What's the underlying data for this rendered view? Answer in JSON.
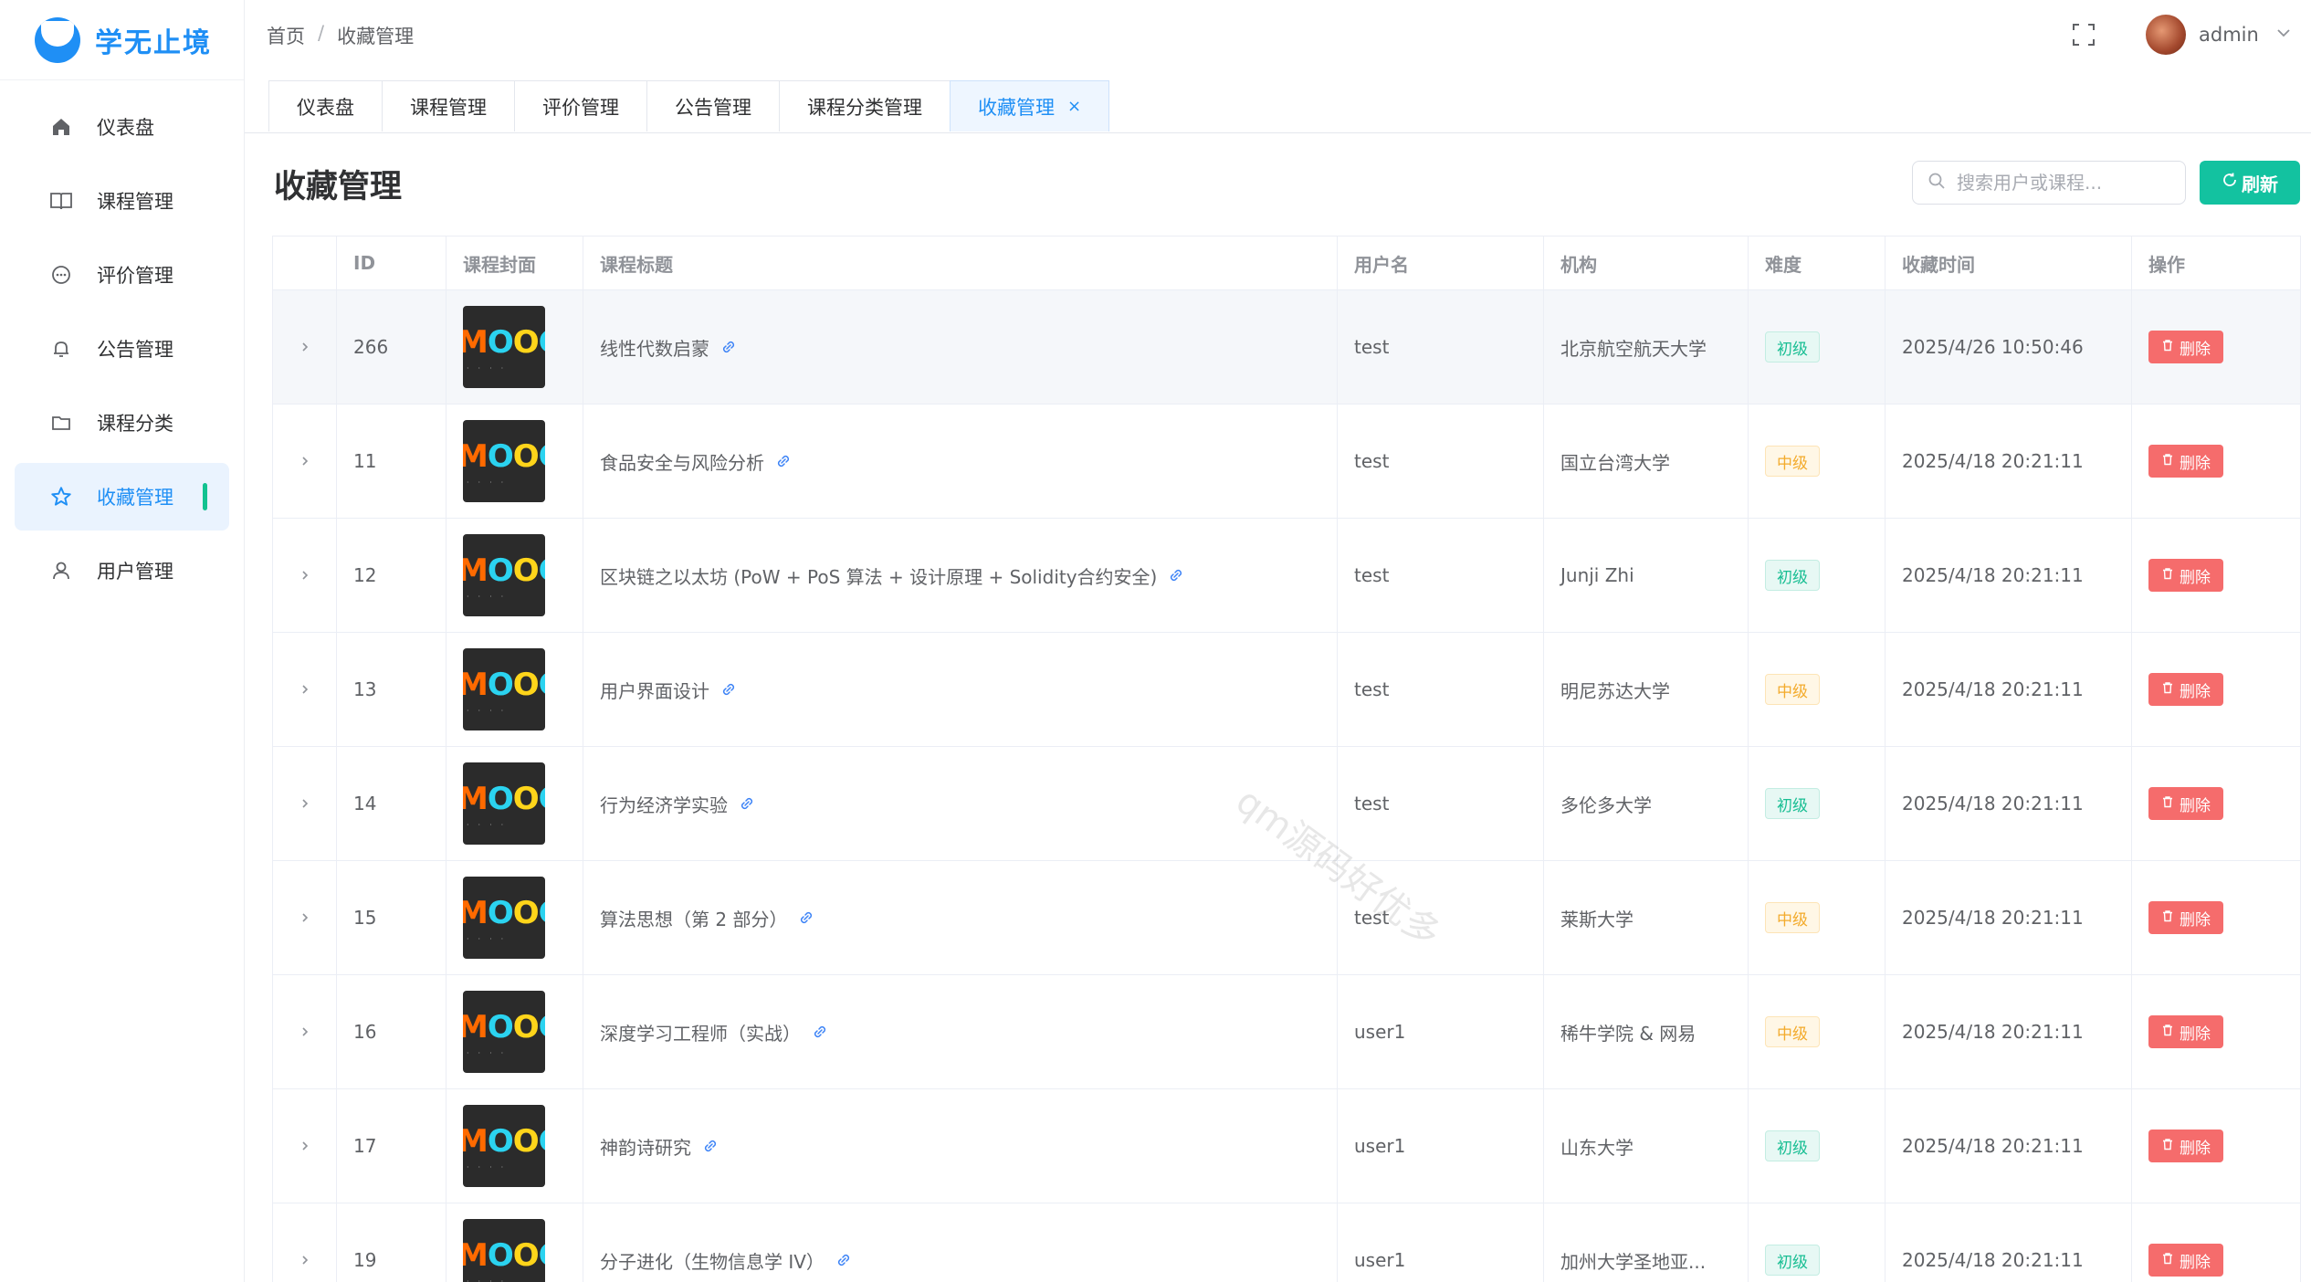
{
  "app": {
    "name": "学无止境"
  },
  "sidebar": {
    "items": [
      {
        "label": "仪表盘",
        "icon": "home-icon"
      },
      {
        "label": "课程管理",
        "icon": "book-icon"
      },
      {
        "label": "评价管理",
        "icon": "chat-icon"
      },
      {
        "label": "公告管理",
        "icon": "bell-icon"
      },
      {
        "label": "课程分类",
        "icon": "folder-icon"
      },
      {
        "label": "收藏管理",
        "icon": "star-icon",
        "active": true
      },
      {
        "label": "用户管理",
        "icon": "user-icon"
      }
    ]
  },
  "header": {
    "breadcrumb": [
      "首页",
      "收藏管理"
    ],
    "username": "admin"
  },
  "tabs": [
    {
      "label": "仪表盘"
    },
    {
      "label": "课程管理"
    },
    {
      "label": "评价管理"
    },
    {
      "label": "公告管理"
    },
    {
      "label": "课程分类管理"
    },
    {
      "label": "收藏管理",
      "active": true,
      "close": "×"
    }
  ],
  "page": {
    "title": "收藏管理",
    "search_placeholder": "搜索用户或课程...",
    "refresh_label": "刷新"
  },
  "table": {
    "columns": [
      "ID",
      "课程封面",
      "课程标题",
      "用户名",
      "机构",
      "难度",
      "收藏时间",
      "操作"
    ],
    "cover_text": "MOOC",
    "delete_label": "删除",
    "rows": [
      {
        "id": "266",
        "title": "线性代数启蒙",
        "user": "test",
        "org": "北京航空航天大学",
        "difficulty": "初级",
        "level": "easy",
        "time": "2025/4/26 10:50:46"
      },
      {
        "id": "11",
        "title": "食品安全与风险分析",
        "user": "test",
        "org": "国立台湾大学",
        "difficulty": "中级",
        "level": "mid",
        "time": "2025/4/18 20:21:11"
      },
      {
        "id": "12",
        "title": "区块链之以太坊 (PoW + PoS 算法 + 设计原理 + Solidity合约安全)",
        "user": "test",
        "org": "Junji Zhi",
        "difficulty": "初级",
        "level": "easy",
        "time": "2025/4/18 20:21:11"
      },
      {
        "id": "13",
        "title": "用户界面设计",
        "user": "test",
        "org": "明尼苏达大学",
        "difficulty": "中级",
        "level": "mid",
        "time": "2025/4/18 20:21:11"
      },
      {
        "id": "14",
        "title": "行为经济学实验",
        "user": "test",
        "org": "多伦多大学",
        "difficulty": "初级",
        "level": "easy",
        "time": "2025/4/18 20:21:11"
      },
      {
        "id": "15",
        "title": "算法思想（第 2 部分）",
        "user": "test",
        "org": "莱斯大学",
        "difficulty": "中级",
        "level": "mid",
        "time": "2025/4/18 20:21:11"
      },
      {
        "id": "16",
        "title": "深度学习工程师（实战）",
        "user": "user1",
        "org": "稀牛学院 & 网易",
        "difficulty": "中级",
        "level": "mid",
        "time": "2025/4/18 20:21:11"
      },
      {
        "id": "17",
        "title": "神韵诗研究",
        "user": "user1",
        "org": "山东大学",
        "difficulty": "初级",
        "level": "easy",
        "time": "2025/4/18 20:21:11"
      },
      {
        "id": "19",
        "title": "分子进化（生物信息学 IV）",
        "user": "user1",
        "org": "加州大学圣地亚...",
        "difficulty": "初级",
        "level": "easy",
        "time": "2025/4/18 20:21:11"
      }
    ]
  },
  "watermark": "qm源码好优多",
  "colors": {
    "primary": "#1f8ff5",
    "success": "#13c2a0",
    "danger": "#f56c6c",
    "warning": "#f3ab2c"
  }
}
